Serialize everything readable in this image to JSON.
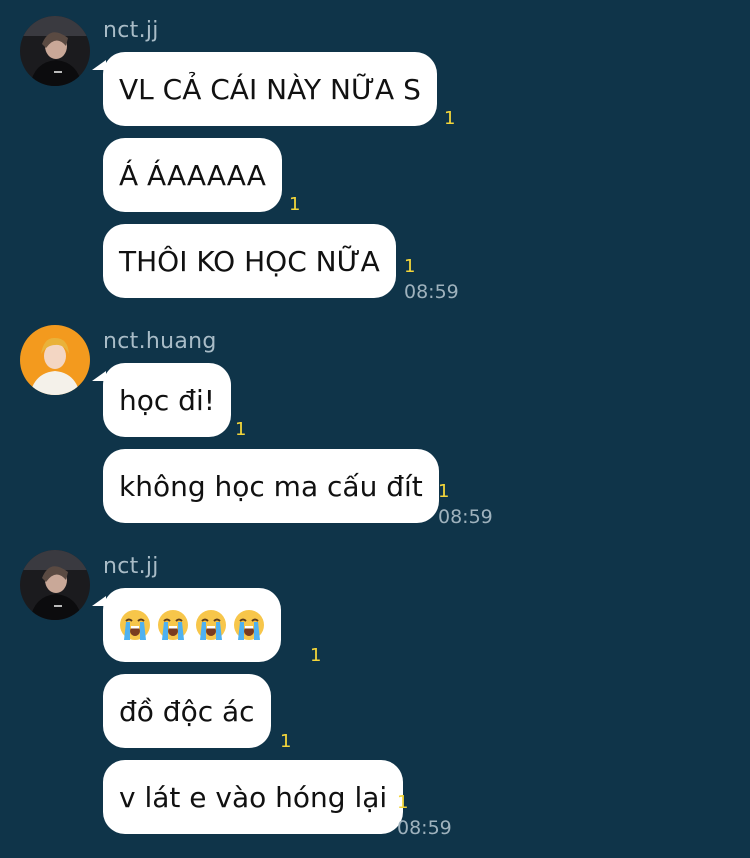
{
  "groups": [
    {
      "sender": "nct.jj",
      "avatar_icon": "dark-portrait-avatar",
      "messages": [
        {
          "text": "VL CẢ CÁI NÀY NỮA S",
          "read": "1"
        },
        {
          "text": "Á ÁAAAAA",
          "read": "1"
        },
        {
          "text": "THÔI KO HỌC NỮA",
          "read": "1",
          "time": "08:59"
        }
      ]
    },
    {
      "sender": "nct.huang",
      "avatar_icon": "orange-portrait-avatar",
      "messages": [
        {
          "text": "học đi!",
          "read": "1"
        },
        {
          "text": "không học ma cấu đít",
          "read": "1",
          "time": "08:59"
        }
      ]
    },
    {
      "sender": "nct.jj",
      "avatar_icon": "dark-portrait-avatar",
      "messages": [
        {
          "emoji": [
            "loudly-crying-face-emoji",
            "loudly-crying-face-emoji",
            "loudly-crying-face-emoji",
            "loudly-crying-face-emoji"
          ],
          "read": "1"
        },
        {
          "text": "đồ độc ác",
          "read": "1"
        },
        {
          "text": "v lát e vào hóng lại",
          "read": "1",
          "time": "08:59"
        }
      ]
    }
  ],
  "colors": {
    "background": "#0f3449",
    "bubble": "#ffffff",
    "read_count": "#f3d53a",
    "sender_name": "#a9bcc7",
    "timestamp": "#9fb2bd"
  }
}
